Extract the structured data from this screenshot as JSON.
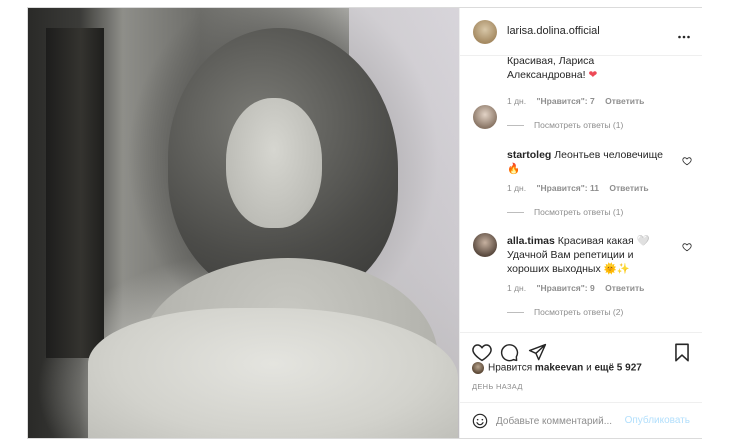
{
  "post": {
    "author": "larisa.dolina.official",
    "more_icon": "more-horizontal-icon"
  },
  "comments": [
    {
      "username": "",
      "text": "Красивая, Лариса Александровна! ❤️",
      "text_line1": "Красивая, Лариса",
      "text_line2": "Александровна!",
      "emoji": "❤️",
      "time": "1 дн.",
      "likes": "\"Нравится\": 7",
      "reply": "Ответить",
      "view_replies": "Посмотреть ответы (1)"
    },
    {
      "username": "startoleg",
      "text": "Леонтьев человечище",
      "emoji": "🔥",
      "time": "1 дн.",
      "likes": "\"Нравится\": 11",
      "reply": "Ответить",
      "view_replies": "Посмотреть ответы (1)"
    },
    {
      "username": "alla.timas",
      "text_line1": "Красивая какая 🤍",
      "text_line2": "Удачной Вам репетиции и",
      "text_line3": "хороших выходных 🌞✨",
      "time": "1 дн.",
      "likes": "\"Нравится\": 9",
      "reply": "Ответить",
      "view_replies": "Посмотреть ответы (2)"
    }
  ],
  "likes_summary": {
    "prefix": "Нравится",
    "user": "makeevan",
    "middle": "и",
    "others": "ещё 5 927"
  },
  "timestamp": "ДЕНЬ НАЗАД",
  "add_comment": {
    "placeholder": "Добавьте комментарий...",
    "publish_label": "Опубликовать"
  },
  "colors": {
    "accent_faded": "#b2dffc",
    "text_primary": "#262626",
    "text_secondary": "#8e8e8e",
    "heart": "#ed4956"
  }
}
